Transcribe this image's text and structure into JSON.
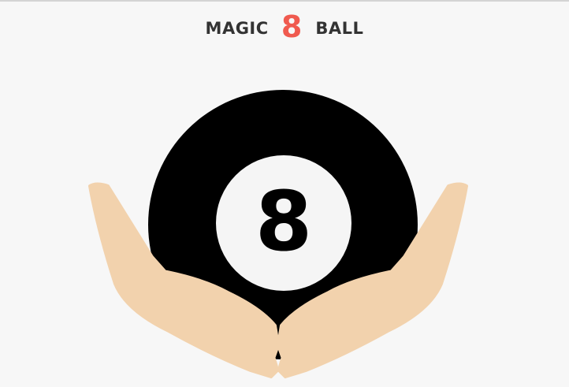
{
  "header": {
    "title_left": "MAGIC",
    "title_number": "8",
    "title_right": "BALL"
  },
  "ball": {
    "window_number": "8"
  },
  "colors": {
    "background": "#f7f7f7",
    "title_text": "#333333",
    "title_accent": "#f05a4f",
    "ball": "#000000",
    "ball_window": "#f5f5f5",
    "hands": "#f2d2ad"
  },
  "icons": {
    "ball": "eight-ball-icon",
    "hands": "cupped-hands-icon"
  }
}
